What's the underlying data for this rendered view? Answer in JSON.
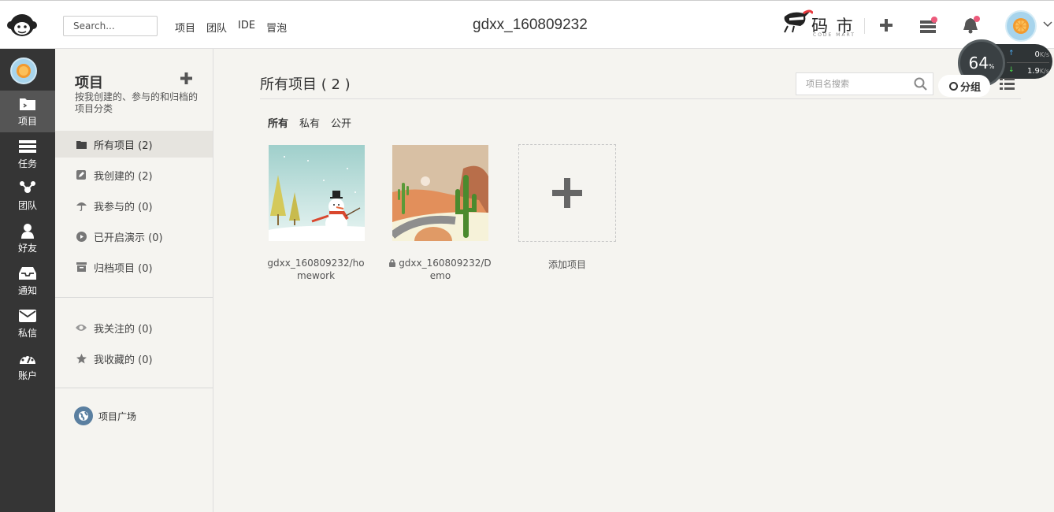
{
  "header": {
    "search_placeholder": "Search...",
    "nav": [
      "项目",
      "团队",
      "IDE",
      "冒泡"
    ],
    "title": "gdxx_160809232",
    "brand_text": "码 市",
    "brand_sub": "CODE MART"
  },
  "speed_widget": {
    "percent": "64",
    "percent_unit": "%",
    "up_value": "0",
    "down_value": "1.9",
    "unit": "K/s"
  },
  "leftbar": {
    "items": [
      {
        "label": "项目",
        "icon": "folder-icon"
      },
      {
        "label": "任务",
        "icon": "tasks-icon"
      },
      {
        "label": "团队",
        "icon": "team-icon"
      },
      {
        "label": "好友",
        "icon": "user-icon"
      },
      {
        "label": "通知",
        "icon": "inbox-icon"
      },
      {
        "label": "私信",
        "icon": "mail-icon"
      },
      {
        "label": "账户",
        "icon": "dashboard-icon"
      }
    ]
  },
  "sidebar": {
    "title": "项目",
    "description": "按我创建的、参与的和归档的项目分类",
    "items": [
      {
        "label": "所有项目 (2)"
      },
      {
        "label": "我创建的 (2)"
      },
      {
        "label": "我参与的 (0)"
      },
      {
        "label": "已开启演示 (0)"
      },
      {
        "label": "归档项目 (0)"
      }
    ],
    "items2": [
      {
        "label": "我关注的 (0)"
      },
      {
        "label": "我收藏的 (0)"
      }
    ],
    "plaza": "项目广场"
  },
  "main": {
    "title": "所有项目 ( 2 )",
    "search_placeholder": "项目名搜索",
    "group_label": "分组",
    "filters": [
      "所有",
      "私有",
      "公开"
    ],
    "projects": [
      {
        "name": "gdxx_160809232/homework",
        "private": false
      },
      {
        "name": "gdxx_160809232/Demo",
        "private": true
      }
    ],
    "add_label": "添加项目"
  }
}
